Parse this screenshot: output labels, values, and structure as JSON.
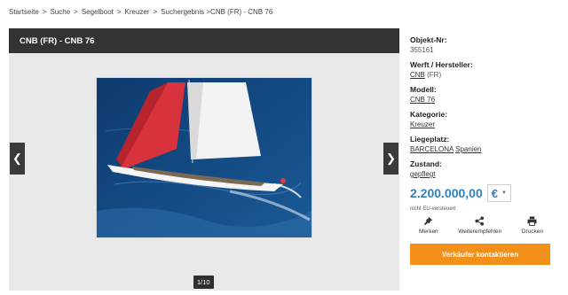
{
  "breadcrumb": {
    "items": [
      "Startseite",
      "Suche",
      "Segelboot",
      "Kreuzer",
      "Suchergebnis >CNB (FR) - CNB 76"
    ]
  },
  "listing": {
    "title": "CNB (FR) - CNB 76"
  },
  "gallery": {
    "counter": "1/10"
  },
  "details": {
    "objekt_nr_label": "Objekt-Nr:",
    "objekt_nr_value": "355161",
    "werft_label": "Werft / Hersteller:",
    "werft_link": "CNB",
    "werft_suffix": " (FR)",
    "modell_label": "Modell:",
    "modell_value": "CNB 76",
    "kategorie_label": "Kategorie:",
    "kategorie_value": "Kreuzer",
    "liegeplatz_label": "Liegeplatz:",
    "liegeplatz_city": "BARCELONA",
    "liegeplatz_country": "Spanien",
    "zustand_label": "Zustand:",
    "zustand_value": "gepflegt"
  },
  "price": {
    "amount": "2.200.000,00",
    "currency": "€",
    "vat_note": "nicht EU-versteuert"
  },
  "actions": {
    "merken": "Merken",
    "weiterempfehlen": "Weiterempfehlen",
    "drucken": "Drucken"
  },
  "contact": {
    "label": "Verkäufer kontaktieren"
  },
  "colors": {
    "accent": "#f2901a",
    "price": "#2f7fc1",
    "title_bar": "#333333"
  }
}
